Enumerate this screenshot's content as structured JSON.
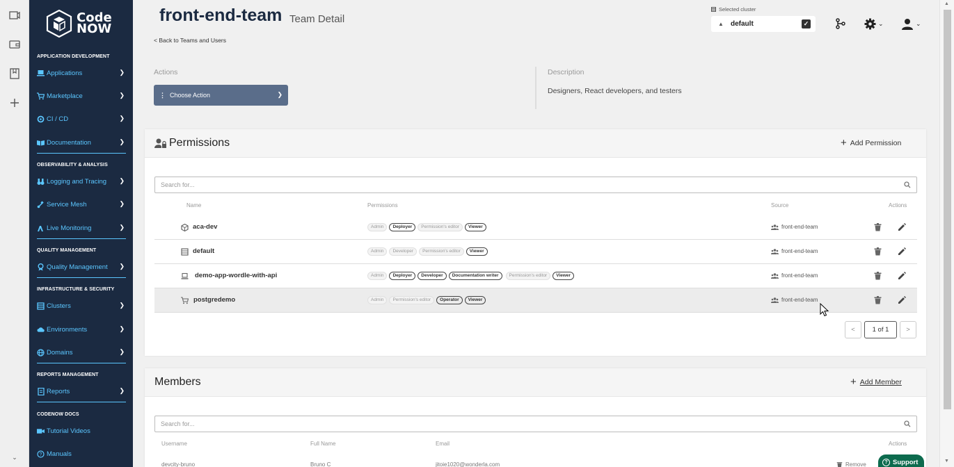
{
  "rail": {
    "icons": [
      "video-icon",
      "wallet-icon",
      "book-icon",
      "plus-icon"
    ]
  },
  "sidebar": {
    "logo_line1": "Code",
    "logo_line2": "NOW",
    "sections": {
      "app_dev": "APPLICATION DEVELOPMENT",
      "observability": "OBSERVABILITY & ANALYSIS",
      "quality": "QUALITY MANAGEMENT",
      "infra": "INFRASTRUCTURE & SECURITY",
      "reports": "REPORTS MANAGEMENT",
      "docs": "CODENOW DOCS"
    },
    "items": {
      "applications": "Applications",
      "marketplace": "Marketplace",
      "cicd": "CI / CD",
      "documentation": "Documentation",
      "logging": "Logging and Tracing",
      "service_mesh": "Service Mesh",
      "live_monitoring": "Live Monitoring",
      "quality_mgmt": "Quality Management",
      "clusters": "Clusters",
      "environments": "Environments",
      "domains": "Domains",
      "reports": "Reports",
      "tutorial_videos": "Tutorial Videos",
      "manuals": "Manuals"
    }
  },
  "header": {
    "title": "front-end-team",
    "subtitle": "Team Detail",
    "back_link": "< Back to Teams and Users",
    "cluster_label": "Selected cluster",
    "cluster_value": "default"
  },
  "actions": {
    "label": "Actions",
    "choose": "Choose Action"
  },
  "description": {
    "label": "Description",
    "text": "Designers, React developers, and testers"
  },
  "permissions": {
    "title": "Permissions",
    "add": "Add Permission",
    "search_placeholder": "Search for...",
    "columns": {
      "name": "Name",
      "permissions": "Permissions",
      "source": "Source",
      "actions": "Actions"
    },
    "rows": [
      {
        "name": "aca-dev",
        "source": "front-end-team",
        "badges": [
          [
            "Admin",
            false
          ],
          [
            "Deployer",
            true
          ],
          [
            "Permission's editor",
            false
          ],
          [
            "Viewer",
            true
          ]
        ]
      },
      {
        "name": "default",
        "source": "front-end-team",
        "badges": [
          [
            "Admin",
            false
          ],
          [
            "Developer",
            false
          ],
          [
            "Permission's editor",
            false
          ],
          [
            "Viewer",
            true
          ]
        ]
      },
      {
        "name": "demo-app-wordle-with-api",
        "source": "front-end-team",
        "badges": [
          [
            "Admin",
            false
          ],
          [
            "Deployer",
            true
          ],
          [
            "Developer",
            true
          ],
          [
            "Documentation writer",
            true
          ],
          [
            "Permission's editor",
            false
          ],
          [
            "Viewer",
            true
          ]
        ]
      },
      {
        "name": "postgredemo",
        "source": "front-end-team",
        "badges": [
          [
            "Admin",
            false
          ],
          [
            "Permission's editor",
            false
          ],
          [
            "Operator",
            true
          ],
          [
            "Viewer",
            true
          ]
        ]
      }
    ],
    "pager": {
      "prev": "<",
      "page": "1 of 1",
      "next": ">"
    }
  },
  "members": {
    "title": "Members",
    "add": "Add Member",
    "search_placeholder": "Search for...",
    "columns": {
      "username": "Username",
      "full_name": "Full Name",
      "email": "Email",
      "actions": "Actions"
    },
    "row": {
      "username": "devcity-bruno",
      "full_name": "Bruno C",
      "email": "jitoie1020@wonderla.com",
      "remove": "Remove"
    }
  },
  "support": "Support"
}
